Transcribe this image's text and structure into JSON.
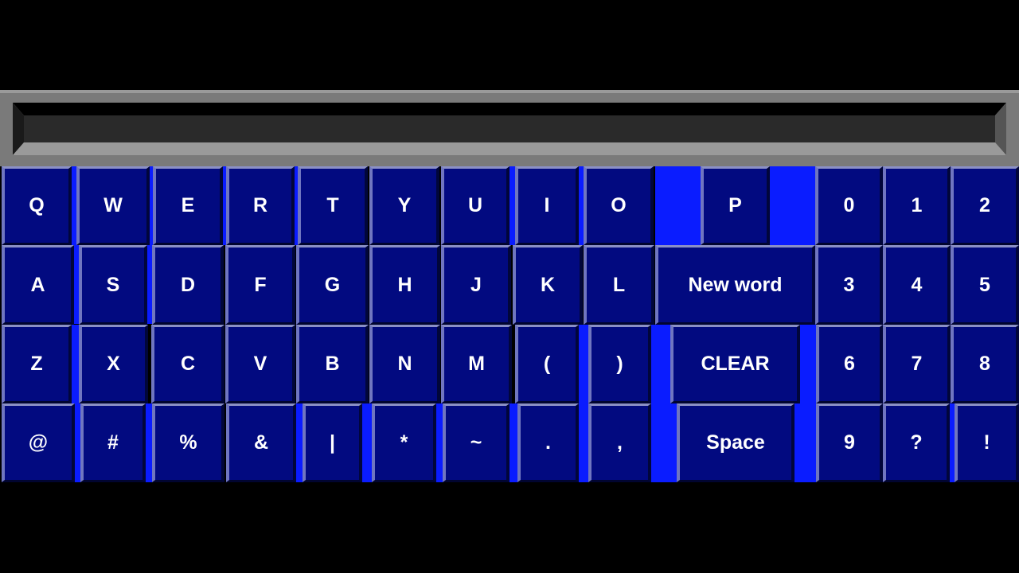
{
  "display": {
    "text": ""
  },
  "colors": {
    "key_face": "#020a80",
    "key_text": "#ffffff",
    "scan_highlight": "#0a1cff",
    "frame": "#7a7a7a",
    "background": "#000000"
  },
  "keyboard": {
    "rows": [
      [
        "Q",
        "W",
        "E",
        "R",
        "T",
        "Y",
        "U",
        "I",
        "O",
        "P",
        "0",
        "1",
        "2"
      ],
      [
        "A",
        "S",
        "D",
        "F",
        "G",
        "H",
        "J",
        "K",
        "L",
        "New word",
        "3",
        "4",
        "5"
      ],
      [
        "Z",
        "X",
        "C",
        "V",
        "B",
        "N",
        "M",
        "(",
        ")",
        "CLEAR",
        "6",
        "7",
        "8"
      ],
      [
        "@",
        "#",
        "%",
        "&",
        "|",
        "*",
        "~",
        ".",
        ",",
        "Space",
        "9",
        "?",
        "!"
      ]
    ]
  }
}
